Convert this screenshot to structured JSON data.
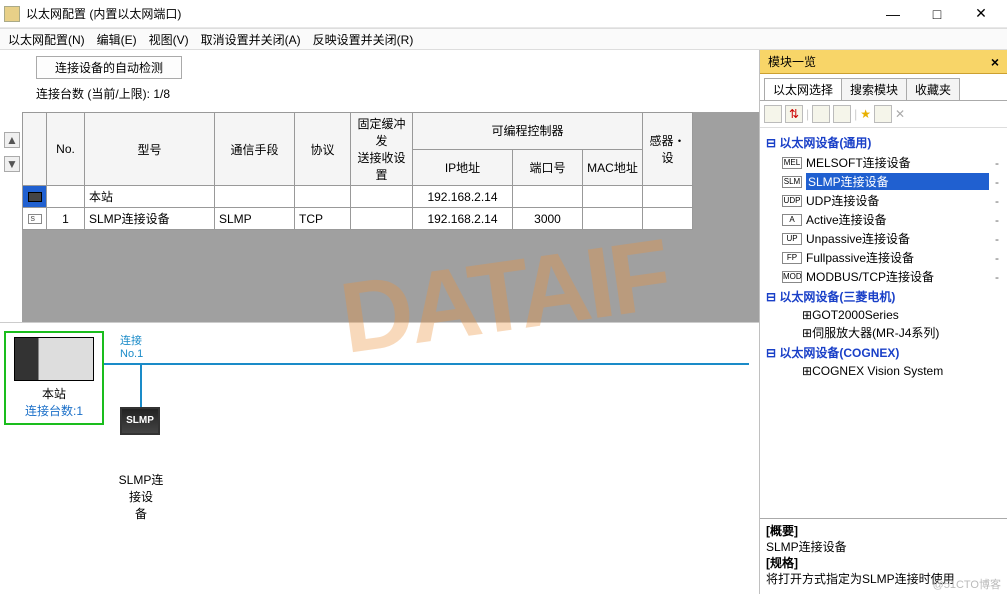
{
  "window": {
    "title": "以太网配置 (内置以太网端口)",
    "buttons": {
      "min": "—",
      "max": "□",
      "close": "✕"
    }
  },
  "menu": [
    "以太网配置(N)",
    "编辑(E)",
    "视图(V)",
    "取消设置并关闭(A)",
    "反映设置并关闭(R)"
  ],
  "controls": {
    "autodetect": "连接设备的自动检测",
    "count_label": "连接台数 (当前/上限):",
    "count_value": "1/8"
  },
  "grid": {
    "headers": {
      "no": "No.",
      "model": "型号",
      "comm": "通信手段",
      "proto": "协议",
      "buffer": "固定缓冲发\n送接收设置",
      "plc": "可编程控制器",
      "ip": "IP地址",
      "port": "端口号",
      "mac": "MAC地址",
      "sensor": "感器・设"
    },
    "rows": [
      {
        "icon": "a",
        "no": "",
        "model": "本站",
        "comm": "",
        "proto": "",
        "buffer": "",
        "ip": "192.168.2.14",
        "port": "",
        "mac": ""
      },
      {
        "icon": "b",
        "no": "1",
        "model": "SLMP连接设备",
        "comm": "SLMP",
        "proto": "TCP",
        "buffer": "",
        "ip": "192.168.2.14",
        "port": "3000",
        "mac": ""
      }
    ]
  },
  "diagram": {
    "host": "本站",
    "hostcount": "连接台数:1",
    "conn": "连接\nNo.1",
    "slmp": "SLMP",
    "slmp_label": "SLMP连接设\n备"
  },
  "panel": {
    "title": "模块一览",
    "tabs": [
      "以太网选择",
      "搜索模块",
      "收藏夹"
    ],
    "tree": {
      "cat1": "以太网设备(通用)",
      "items1": [
        {
          "ic": "MEL",
          "name": "MELSOFT连接设备"
        },
        {
          "ic": "SLM",
          "name": "SLMP连接设备",
          "sel": true
        },
        {
          "ic": "UDP",
          "name": "UDP连接设备"
        },
        {
          "ic": "A",
          "name": "Active连接设备"
        },
        {
          "ic": "UP",
          "name": "Unpassive连接设备"
        },
        {
          "ic": "FP",
          "name": "Fullpassive连接设备"
        },
        {
          "ic": "MOD",
          "name": "MODBUS/TCP连接设备"
        }
      ],
      "cat2": "以太网设备(三菱电机)",
      "items2": [
        "GOT2000Series",
        "伺服放大器(MR-J4系列)"
      ],
      "cat3": "以太网设备(COGNEX)",
      "items3": [
        "COGNEX Vision System"
      ]
    },
    "detail": {
      "h1": "[概要]",
      "l1": "SLMP连接设备",
      "h2": "[规格]",
      "l2": "将打开方式指定为SLMP连接时使用"
    }
  },
  "watermark": "DATAIF",
  "credit": "@51CTO博客"
}
